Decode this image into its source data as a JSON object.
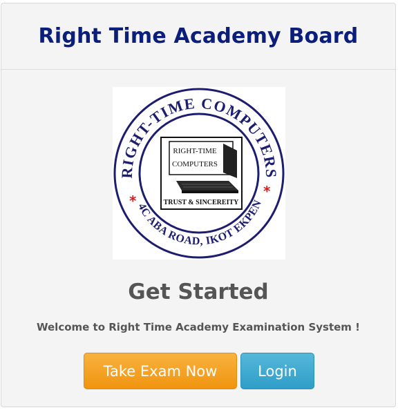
{
  "header": {
    "title": "Right Time Academy Board"
  },
  "logo": {
    "ring_text_top": "RIGHT-TIME COMPUTERS",
    "ring_text_bottom": "144C ABA ROAD, IKOT EKPENE",
    "inner_line1": "RIGHT-TIME",
    "inner_line2": "COMPUTERS",
    "inner_motto": "TRUST & SINCEREITY",
    "icon": "laptop-icon",
    "colors": {
      "ring_text": "#1c1d6e",
      "star": "#d42020"
    }
  },
  "main": {
    "heading": "Get Started",
    "welcome": "Welcome to Right Time Academy Examination System !"
  },
  "buttons": {
    "take_exam": "Take Exam Now",
    "login": "Login"
  },
  "colors": {
    "title": "#0b1f7a",
    "exam_button": "#f7a52a",
    "login_button": "#3aa9d1"
  }
}
